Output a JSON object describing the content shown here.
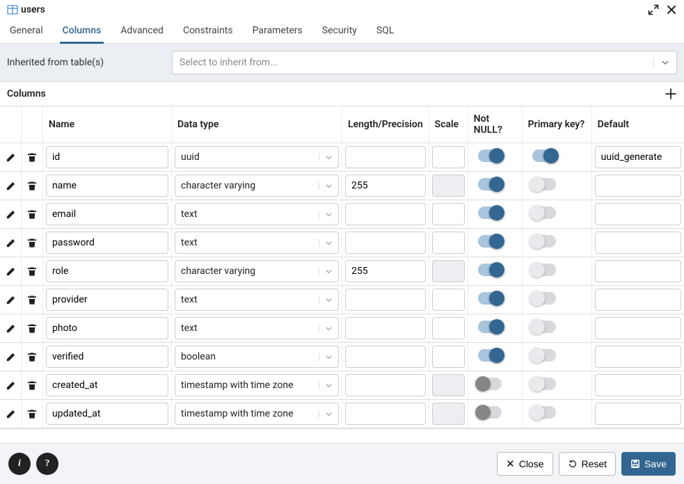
{
  "header": {
    "title": "users"
  },
  "tabs": [
    "General",
    "Columns",
    "Advanced",
    "Constraints",
    "Parameters",
    "Security",
    "SQL"
  ],
  "active_tab": 1,
  "inherit": {
    "label": "Inherited from table(s)",
    "placeholder": "Select to inherit from..."
  },
  "section_title": "Columns",
  "cols": [
    "Name",
    "Data type",
    "Length/Precision",
    "Scale",
    "Not NULL?",
    "Primary key?",
    "Default"
  ],
  "rows": [
    {
      "name": "id",
      "type": "uuid",
      "len": "",
      "scale": "",
      "len_dis": false,
      "scale_dis": false,
      "nn": true,
      "nn_dark": false,
      "pk": true,
      "def": "uuid_generate"
    },
    {
      "name": "name",
      "type": "character varying",
      "len": "255",
      "scale": "",
      "len_dis": false,
      "scale_dis": true,
      "nn": true,
      "nn_dark": false,
      "pk": false,
      "def": ""
    },
    {
      "name": "email",
      "type": "text",
      "len": "",
      "scale": "",
      "len_dis": false,
      "scale_dis": false,
      "nn": true,
      "nn_dark": false,
      "pk": false,
      "def": ""
    },
    {
      "name": "password",
      "type": "text",
      "len": "",
      "scale": "",
      "len_dis": false,
      "scale_dis": false,
      "nn": true,
      "nn_dark": false,
      "pk": false,
      "def": ""
    },
    {
      "name": "role",
      "type": "character varying",
      "len": "255",
      "scale": "",
      "len_dis": false,
      "scale_dis": true,
      "nn": true,
      "nn_dark": false,
      "pk": false,
      "def": ""
    },
    {
      "name": "provider",
      "type": "text",
      "len": "",
      "scale": "",
      "len_dis": false,
      "scale_dis": false,
      "nn": true,
      "nn_dark": false,
      "pk": false,
      "def": ""
    },
    {
      "name": "photo",
      "type": "text",
      "len": "",
      "scale": "",
      "len_dis": false,
      "scale_dis": false,
      "nn": true,
      "nn_dark": false,
      "pk": false,
      "def": ""
    },
    {
      "name": "verified",
      "type": "boolean",
      "len": "",
      "scale": "",
      "len_dis": false,
      "scale_dis": false,
      "nn": true,
      "nn_dark": false,
      "pk": false,
      "def": ""
    },
    {
      "name": "created_at",
      "type": "timestamp with time zone",
      "len": "",
      "scale": "",
      "len_dis": false,
      "scale_dis": true,
      "nn": false,
      "nn_dark": true,
      "pk": false,
      "def": ""
    },
    {
      "name": "updated_at",
      "type": "timestamp with time zone",
      "len": "",
      "scale": "",
      "len_dis": false,
      "scale_dis": true,
      "nn": false,
      "nn_dark": true,
      "pk": false,
      "def": ""
    }
  ],
  "footer": {
    "close": "Close",
    "reset": "Reset",
    "save": "Save"
  }
}
